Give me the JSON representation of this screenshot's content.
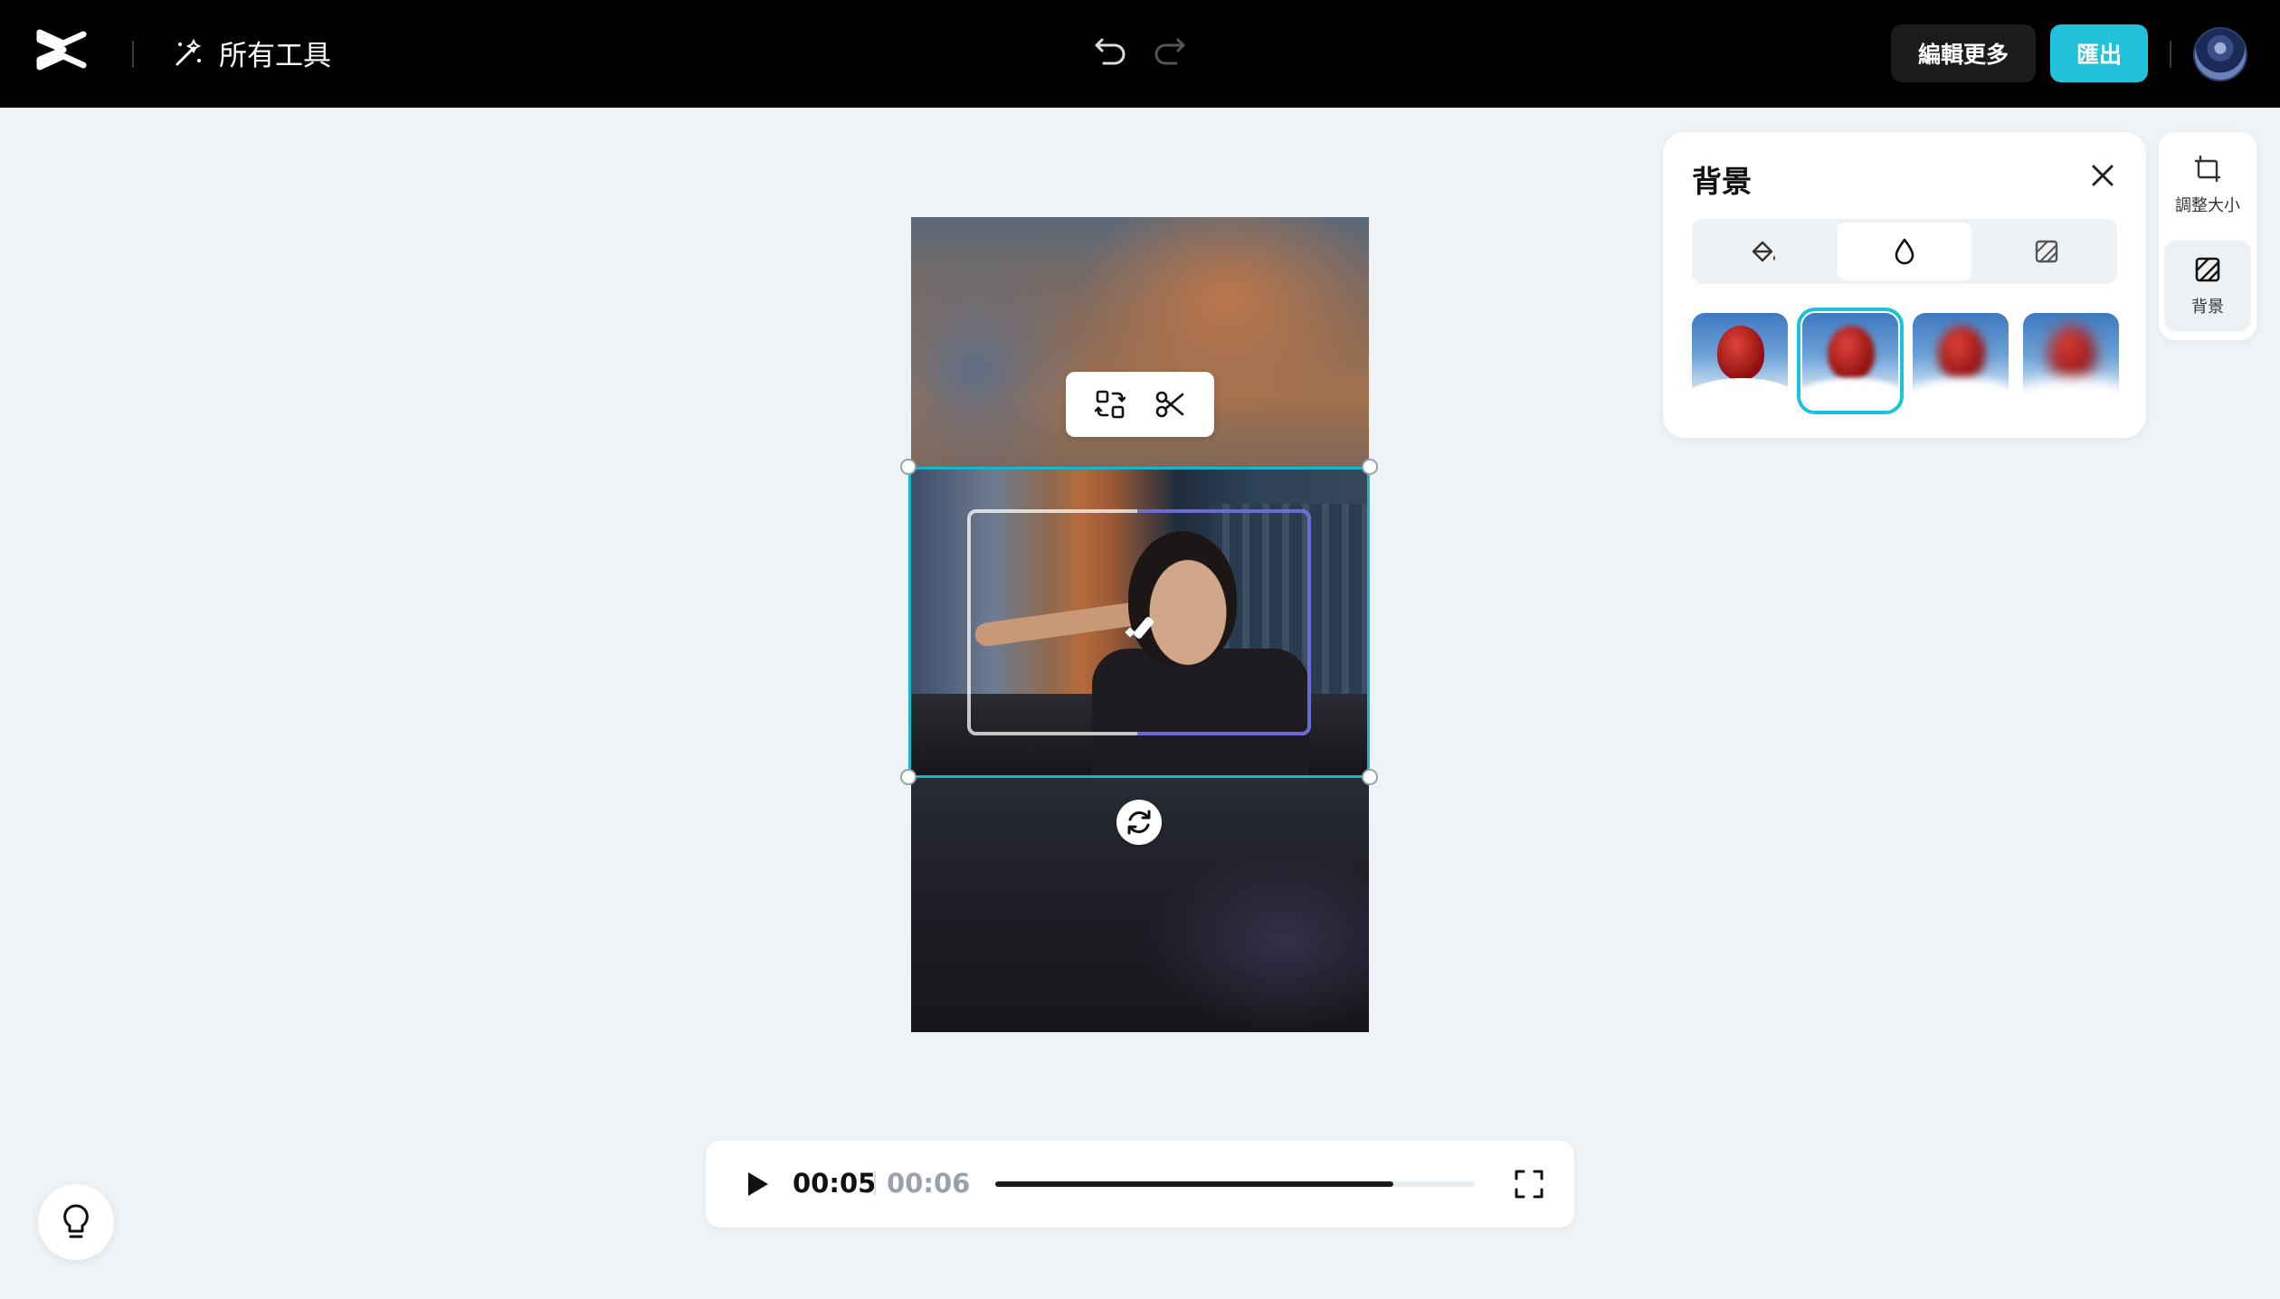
{
  "header": {
    "all_tools_label": "所有工具",
    "edit_more_label": "編輯更多",
    "export_label": "匯出",
    "accent_color": "#22c1dc",
    "icons": [
      "capcut-logo-icon",
      "magic-wand-icon",
      "undo-icon",
      "redo-icon",
      "avatar"
    ]
  },
  "canvas": {
    "float_toolbar_icons": [
      "replace-icon",
      "scissors-icon"
    ],
    "rotate_icon": "rotate-icon"
  },
  "background_panel": {
    "title": "背景",
    "tabs": [
      {
        "icon": "paint-bucket-icon",
        "active": false
      },
      {
        "icon": "blur-drop-icon",
        "active": true
      },
      {
        "icon": "pattern-icon",
        "active": false
      }
    ],
    "selected_thumbnail": 2,
    "thumbnail_count": 4,
    "selection_color": "#1cc2dc"
  },
  "right_rail": {
    "items": [
      {
        "label": "調整大小",
        "icon": "resize-icon",
        "active": false
      },
      {
        "label": "背景",
        "icon": "background-icon",
        "active": true
      }
    ]
  },
  "player": {
    "current_time": "00:05",
    "total_time": "00:06",
    "progress": 0.83
  }
}
